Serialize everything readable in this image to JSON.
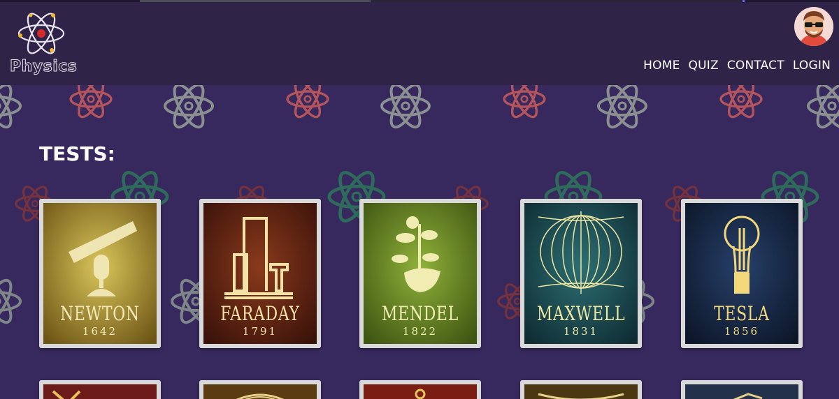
{
  "brand": {
    "name": "Physics"
  },
  "nav": {
    "items": [
      "HOME",
      "QUIZ",
      "CONTACT",
      "LOGIN"
    ]
  },
  "section": {
    "title": "TESTS:"
  },
  "tests": [
    {
      "name": "NEWTON",
      "year": "1642",
      "bg": "#b39a2c",
      "ink": "#f1e9b8"
    },
    {
      "name": "FARADAY",
      "year": "1791",
      "bg": "#5e2413",
      "ink": "#f3e3a6"
    },
    {
      "name": "MENDEL",
      "year": "1822",
      "bg": "#6c8d24",
      "ink": "#f0ecb2"
    },
    {
      "name": "MAXWELL",
      "year": "1831",
      "bg": "#1d4d52",
      "ink": "#eee7a3"
    },
    {
      "name": "TESLA",
      "year": "1856",
      "bg": "#172a45",
      "ink": "#f2d77b"
    }
  ],
  "tests_row2": [
    {
      "bg": "#6d1a1a"
    },
    {
      "bg": "#5a3b12"
    },
    {
      "bg": "#7a1d12"
    },
    {
      "bg": "#4a3812"
    },
    {
      "bg": "#23314a"
    }
  ],
  "colors": {
    "page_bg": "#37295d",
    "header_bg": "#2f2447",
    "atom_grey": "#8a8f92",
    "atom_red": "#b4545d",
    "atom_green": "#2e6b5c"
  },
  "icons": {
    "logo": "atom-icon",
    "profile": "avatar"
  }
}
